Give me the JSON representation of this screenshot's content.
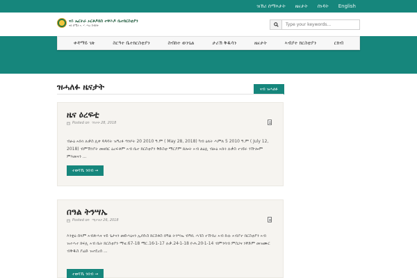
{
  "topnav": {
    "items": [
      "ዝኽሪ ሰማእታት",
      "ዜናታት",
      "ሰነዳት",
      "English"
    ]
  },
  "header": {
    "logo_line1": "ናይ ኤርትራ ኦርቶዶክስ ተዋሕዶ ቤተክርስቲያን",
    "logo_line2": "ናይ ሰሜን ኣ. ሃ. ሃገረ ስብከት",
    "search_placeholder": "Type your keywords..."
  },
  "mainnav": {
    "items": [
      "ቀዳማይ ገጽ",
      "ስርዓተ ቤተክርስቲያን",
      "ስብከተ ወንጌል",
      "ታሪኽ ቅዱሳን",
      "ዜናታት",
      "ኣብያተ ክርስቲያን",
      "ርክብ"
    ]
  },
  "page": {
    "title": "ዝሓለፉ ዜናታት",
    "back_label": "ናብ ዝሓለፉ"
  },
  "posts": [
    {
      "title": "ዜና ዕረፍቲ",
      "meta_prefix": "Posted on",
      "date": "ግንቦት 28, 2018",
      "excerpt": "ብፁዕ ኣቡነ ሉቃስ ሊቀ ጳጳሳት ዝዓረፉ ግንቦት 20 2010 ዓ.ም ( May 28, 2018) ካብ ዕለት ሓምለ 5 2010 ዓ.ም ( July 12, 2018) ብምኽንያት መዘክር ዕረፍቶም ኣብ ቤተ ክርስቲያን ቅድስቲ ማርያም ጸሎት ኣብ ልዕሊ ብፁዕ ኣቡነ ሉቃስ ተገይሩ ንዅሎም ምእመናን ...",
      "more_label": "ተወሳኺ ንበብ ➞"
    },
    {
      "title": "በዓል ትንሣኤ",
      "meta_prefix": "Posted on",
      "date": "ሚያዝያ 26, 2018",
      "excerpt": "እንቋዕ ሰላም ኣብጽሓና ናይ ጌታናን መድሓኒናን ኢየሱስ ክርስቶስ በዓል ትንሣኤ ብዓቢ ሓጎስ ተኸብረ ኣብ ኩሉ ኣብያተ ክርስቲያን ኣብ ዝተሓተ ክፍሊ ኣብ ቤት ክርስቲያን ማቴ.67-18 ማር.16፡1-17 ሉቃ.24፡1-18 ዮሐ.20፡1-14 ብምንባብ ምስጋና ነቐድም መዝሙር ብቅዱስ ያሬድ ዝተደረሰ ...",
      "more_label": "ተወሳኺ ንበብ ➞"
    }
  ]
}
